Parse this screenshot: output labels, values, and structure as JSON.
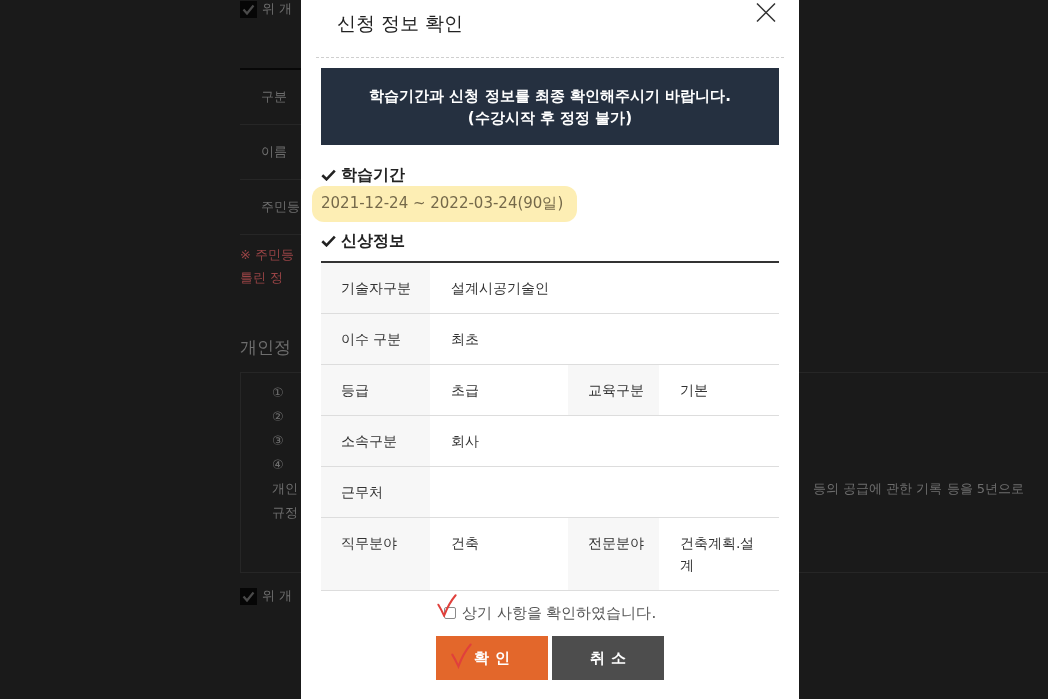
{
  "background_page": {
    "consent_top": {
      "label": "위 개",
      "checked": true
    },
    "info_rows": [
      {
        "label": "구분"
      },
      {
        "label": "이름"
      },
      {
        "label": "주민등"
      }
    ],
    "notice_lines": [
      "※ 주민등",
      "틀린 정"
    ],
    "privacy": {
      "title": "개인정",
      "lines": [
        "①",
        "②",
        "③",
        "④",
        "개인",
        "규정"
      ],
      "line_5_continuation": "등의 공급에 관한 기록 등을 5년으로"
    },
    "consent_bottom": {
      "label": "위 개",
      "checked": true
    }
  },
  "dialog": {
    "title": "신청 정보 확인",
    "notice": [
      "학습기간과 신청 정보를 최종 확인해주시기 바랍니다.",
      "(수강시작 후 정정 불가)"
    ],
    "study_period": {
      "heading": "학습기간",
      "value": "2021-12-24 ~ 2022-03-24(90일)",
      "highlighted": true
    },
    "personal_info": {
      "heading": "신상정보",
      "rows": [
        {
          "cells": [
            {
              "label": "기술자구분",
              "value": "설계시공기술인"
            }
          ]
        },
        {
          "cells": [
            {
              "label": "이수 구분",
              "value": "최초"
            }
          ]
        },
        {
          "cells": [
            {
              "label": "등급",
              "value": "초급"
            },
            {
              "label": "교육구분",
              "value": "기본"
            }
          ]
        },
        {
          "cells": [
            {
              "label": "소속구분",
              "value": "회사"
            }
          ]
        },
        {
          "cells": [
            {
              "label": "근무처"
            }
          ]
        },
        {
          "cells": [
            {
              "label": "직무분야",
              "value": "건축"
            },
            {
              "label": "전문분야",
              "value": "건축계획.설계"
            }
          ]
        }
      ]
    },
    "confirm_checkbox": {
      "label": "상기 사항을 확인하였습니다.",
      "checked": false
    },
    "buttons": [
      {
        "label": "확 인",
        "kind": "primary"
      },
      {
        "label": "취 소",
        "kind": "secondary"
      }
    ]
  }
}
